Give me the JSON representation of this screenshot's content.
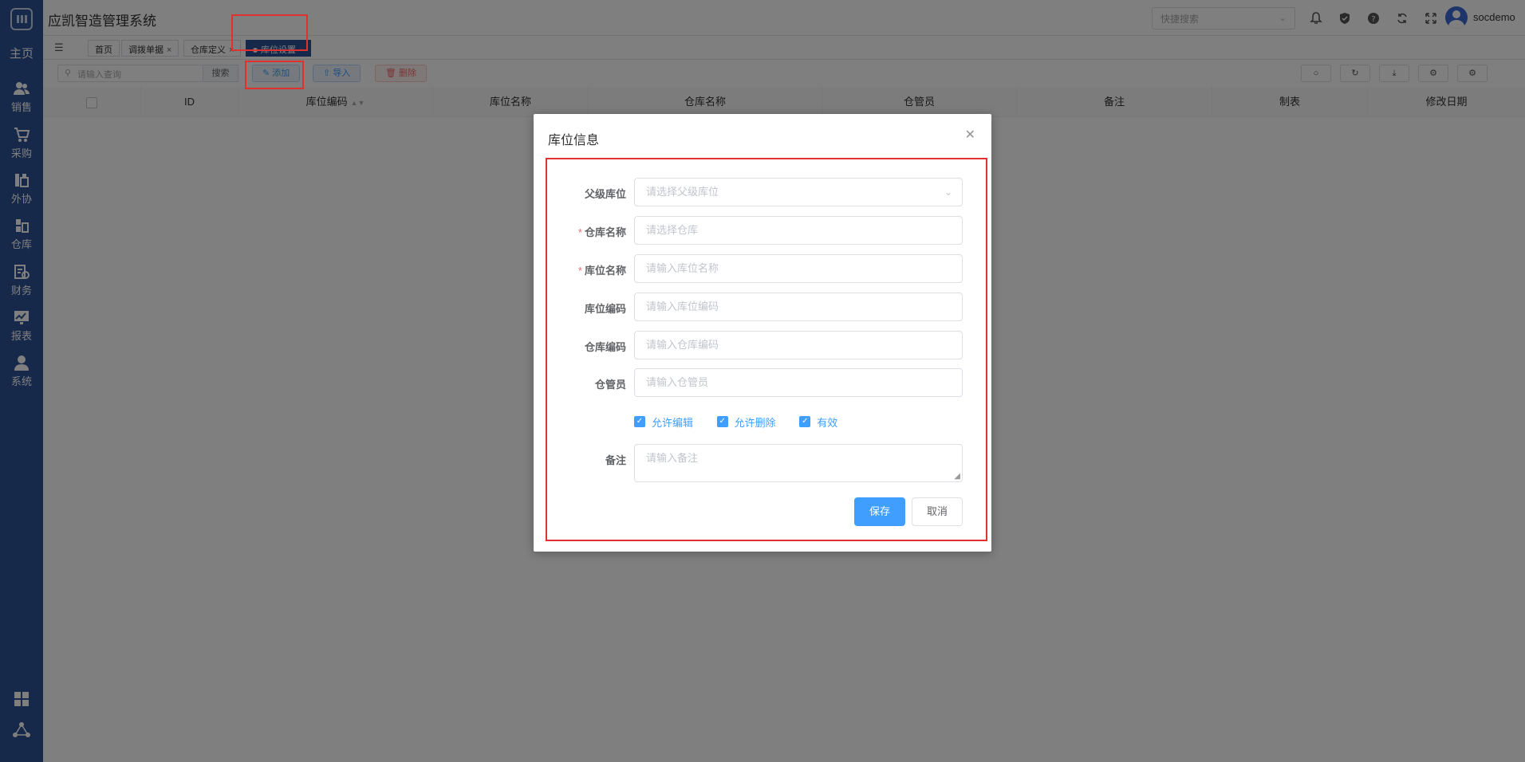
{
  "app": {
    "title": "应凯智造管理系统"
  },
  "sidebar": {
    "home": "主页",
    "items": [
      {
        "label": "销售",
        "icon": "users-icon"
      },
      {
        "label": "采购",
        "icon": "cart-icon"
      },
      {
        "label": "外协",
        "icon": "outsource-icon"
      },
      {
        "label": "仓库",
        "icon": "warehouse-icon"
      },
      {
        "label": "财务",
        "icon": "finance-icon"
      },
      {
        "label": "报表",
        "icon": "report-icon"
      },
      {
        "label": "系统",
        "icon": "system-user-icon"
      }
    ]
  },
  "header": {
    "quick_search_placeholder": "快捷搜索",
    "username": "socdemo"
  },
  "tabs": [
    {
      "label": "首页",
      "closable": false,
      "active": false
    },
    {
      "label": "调拨单据",
      "closable": true,
      "active": false
    },
    {
      "label": "仓库定义",
      "closable": true,
      "active": false
    },
    {
      "label": "库位设置",
      "closable": true,
      "active": true
    }
  ],
  "toolbar": {
    "search_placeholder": "请输入查询",
    "search_label": "搜索",
    "add_label": "添加",
    "import_label": "导入",
    "delete_label": "删除"
  },
  "table": {
    "columns": [
      "ID",
      "库位编码",
      "库位名称",
      "仓库名称",
      "仓管员",
      "备注",
      "制表",
      "修改日期"
    ]
  },
  "modal": {
    "title": "库位信息",
    "fields": {
      "parent": {
        "label": "父级库位",
        "placeholder": "请选择父级库位",
        "required": false
      },
      "warehouse": {
        "label": "仓库名称",
        "placeholder": "请选择仓库",
        "required": true
      },
      "location_name": {
        "label": "库位名称",
        "placeholder": "请输入库位名称",
        "required": true
      },
      "location_code": {
        "label": "库位编码",
        "placeholder": "请输入库位编码",
        "required": false
      },
      "warehouse_code": {
        "label": "仓库编码",
        "placeholder": "请输入仓库编码",
        "required": false
      },
      "keeper": {
        "label": "仓管员",
        "placeholder": "请输入仓管员",
        "required": false
      },
      "remark": {
        "label": "备注",
        "placeholder": "请输入备注",
        "required": false
      }
    },
    "checkboxes": [
      {
        "label": "允许编辑",
        "checked": true
      },
      {
        "label": "允许删除",
        "checked": true
      },
      {
        "label": "有效",
        "checked": true
      }
    ],
    "save_label": "保存",
    "cancel_label": "取消"
  },
  "colors": {
    "sidebar": "#2e5296",
    "primary": "#409eff",
    "danger": "#f56c6c",
    "highlight": "#e03030"
  }
}
